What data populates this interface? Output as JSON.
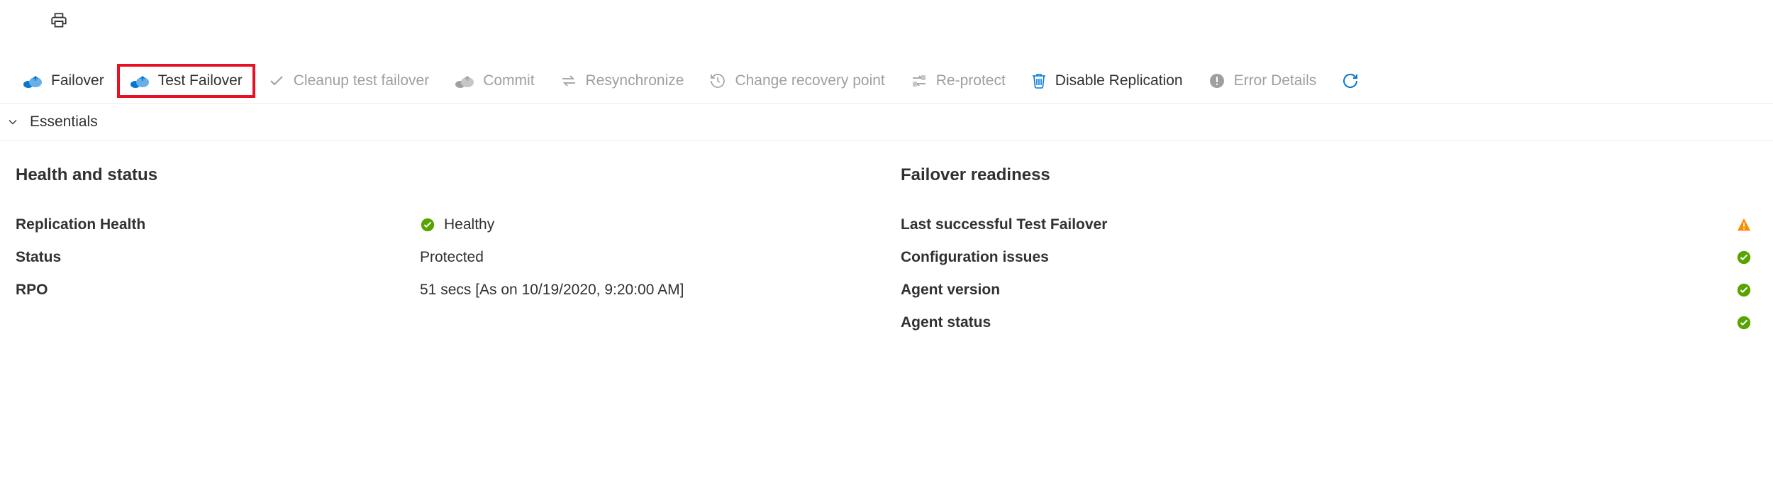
{
  "toolbar": {
    "failover": "Failover",
    "test_failover": "Test Failover",
    "cleanup_test_failover": "Cleanup test failover",
    "commit": "Commit",
    "resynchronize": "Resynchronize",
    "change_recovery_point": "Change recovery point",
    "re_protect": "Re-protect",
    "disable_replication": "Disable Replication",
    "error_details": "Error Details"
  },
  "essentials_toggle": "Essentials",
  "health": {
    "title": "Health and status",
    "replication_health_label": "Replication Health",
    "replication_health_value": "Healthy",
    "status_label": "Status",
    "status_value": "Protected",
    "rpo_label": "RPO",
    "rpo_value": "51 secs [As on 10/19/2020, 9:20:00 AM]"
  },
  "readiness": {
    "title": "Failover readiness",
    "last_test_failover_label": "Last successful Test Failover",
    "configuration_issues_label": "Configuration issues",
    "agent_version_label": "Agent version",
    "agent_status_label": "Agent status"
  }
}
